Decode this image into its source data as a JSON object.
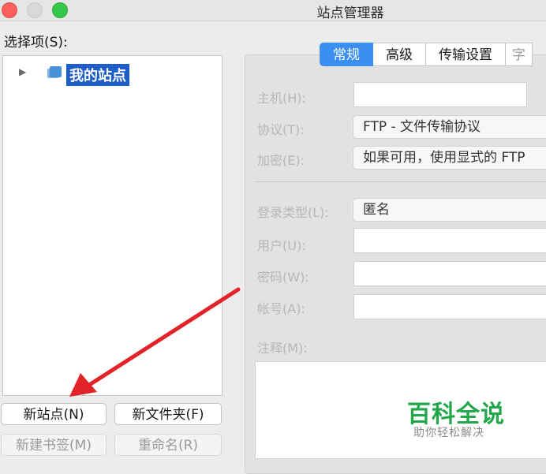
{
  "window": {
    "title": "站点管理器"
  },
  "left": {
    "select_label": "选择项(S):",
    "tree": {
      "root": {
        "label": "我的站点"
      }
    },
    "buttons": {
      "new_site": "新站点(N)",
      "new_folder": "新文件夹(F)",
      "new_bookmark": "新建书签(M)",
      "rename": "重命名(R)"
    }
  },
  "tabs": [
    {
      "label": "常规",
      "active": true
    },
    {
      "label": "高级",
      "active": false
    },
    {
      "label": "传输设置",
      "active": false
    }
  ],
  "form": {
    "host_label": "主机(H):",
    "protocol_label": "协议(T):",
    "protocol_value": "FTP - 文件传输协议",
    "encryption_label": "加密(E):",
    "encryption_value": "如果可用，使用显式的 FTP",
    "logon_type_label": "登录类型(L):",
    "logon_type_value": "匿名",
    "user_label": "用户(U):",
    "password_label": "密码(W):",
    "account_label": "帐号(A):",
    "comments_label": "注释(M):"
  },
  "watermark": {
    "title": "百科全说",
    "subtitle": "助你轻松解决"
  },
  "colors": {
    "accent": "#3b8ff0",
    "selection": "#1f5dc7",
    "annotation_arrow": "#e3232a",
    "watermark": "#22a84a"
  }
}
